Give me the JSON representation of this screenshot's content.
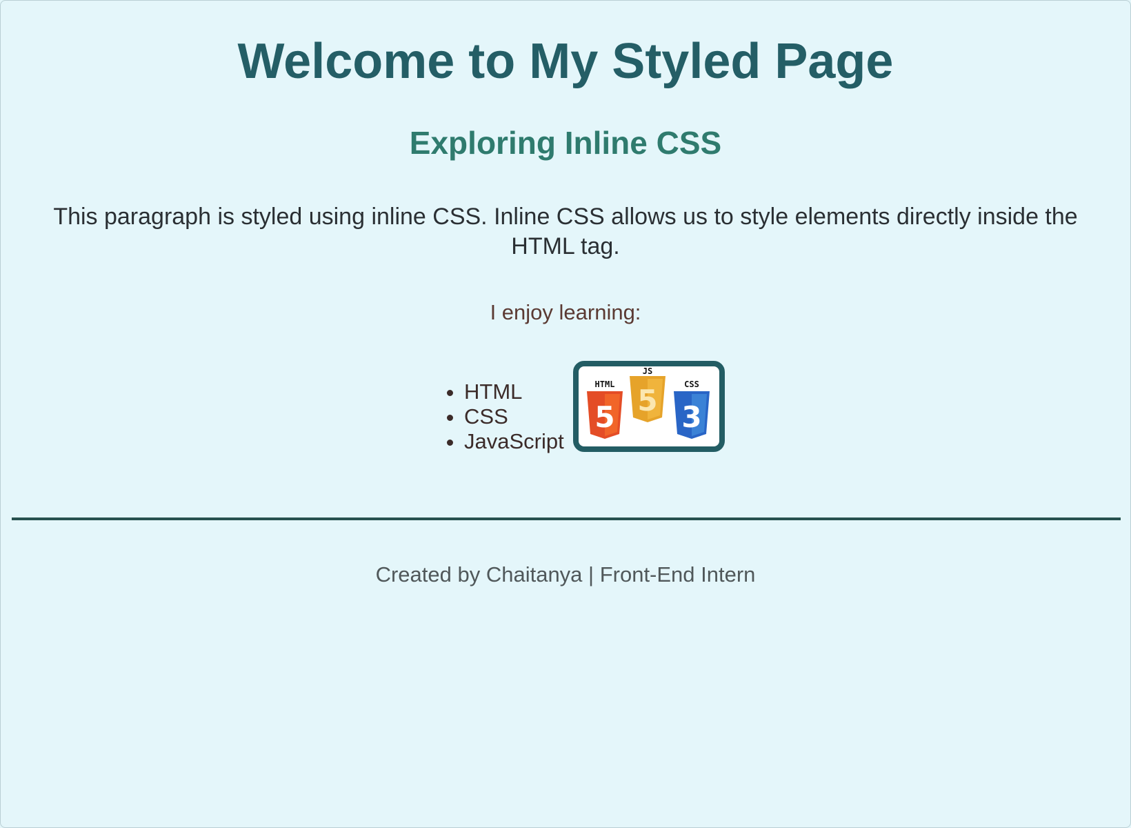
{
  "header": {
    "title": "Welcome to My Styled Page",
    "subtitle": "Exploring Inline CSS"
  },
  "content": {
    "paragraph": "This paragraph is styled using inline CSS. Inline CSS allows us to style elements directly inside the HTML tag.",
    "enjoy_label": "I enjoy learning:",
    "skills": [
      "HTML",
      "CSS",
      "JavaScript"
    ],
    "logo_badges": {
      "html_label": "HTML",
      "js_label": "JS",
      "css_label": "CSS",
      "html_number": "5",
      "js_number": "5",
      "css_number": "3"
    }
  },
  "footer": {
    "credit": "Created by Chaitanya | Front-End Intern"
  },
  "colors": {
    "background": "#e4f6fa",
    "title": "#245e66",
    "subtitle": "#2f7b6e",
    "paragraph": "#2a2f33",
    "enjoy": "#5b3a33",
    "list": "#3b2b29",
    "divider": "#27514f",
    "footer": "#50585a",
    "logo_border": "#235d64",
    "html_orange": "#e44d26",
    "js_yellow": "#f0a823",
    "css_blue": "#2965f1"
  },
  "icons": {
    "html5_logo": "html5-shield-icon",
    "js_logo": "javascript-shield-icon",
    "css3_logo": "css3-shield-icon"
  }
}
